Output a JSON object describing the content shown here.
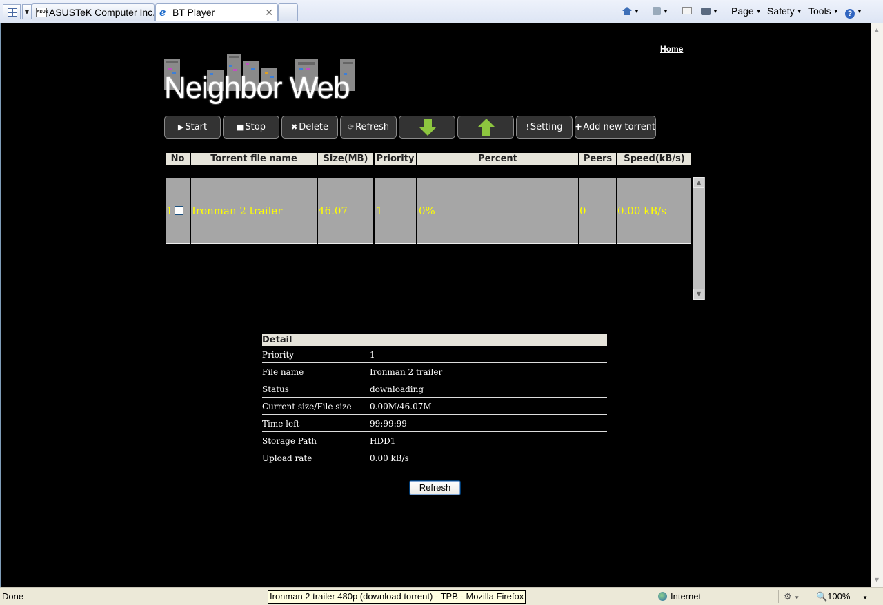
{
  "browser": {
    "tabs": [
      {
        "label": "ASUSTeK Computer Inc...",
        "icon": "asus-favicon-icon",
        "active": false
      },
      {
        "label": "BT Player",
        "icon": "ie-favicon-icon",
        "active": true,
        "close": "✕"
      }
    ],
    "command_bar": {
      "page": "Page",
      "safety": "Safety",
      "tools": "Tools",
      "help": "?"
    }
  },
  "header": {
    "home_link": "Home",
    "logo_text": "Neighbor Web"
  },
  "toolbar": {
    "start": "Start",
    "stop": "Stop",
    "delete": "Delete",
    "refresh": "Refresh",
    "setting": "Setting",
    "add_new": "Add new torrent",
    "download_icon": "arrow-down-icon",
    "upload_icon": "arrow-up-icon"
  },
  "table": {
    "columns": [
      "No",
      "Torrent file name",
      "Size(MB)",
      "Priority",
      "Percent",
      "Peers",
      "Speed(kB/s)"
    ],
    "rows": [
      {
        "no": "1",
        "name": "Ironman 2 trailer",
        "size": "46.07",
        "priority": "1",
        "percent": "0%",
        "peers": "0",
        "speed": "0.00 kB/s",
        "checked": false
      }
    ]
  },
  "detail": {
    "title": "Detail",
    "rows": [
      {
        "label": "Priority",
        "value": "1"
      },
      {
        "label": "File name",
        "value": "Ironman 2 trailer"
      },
      {
        "label": "Status",
        "value": "downloading"
      },
      {
        "label": "Current size/File size",
        "value": "0.00M/46.07M"
      },
      {
        "label": "Time left",
        "value": "99:99:99"
      },
      {
        "label": "Storage Path",
        "value": "HDD1"
      },
      {
        "label": "Upload rate",
        "value": "0.00 kB/s"
      }
    ],
    "refresh_button": "Refresh"
  },
  "statusbar": {
    "status": "Done",
    "tooltip": "Ironman 2 trailer 480p (download torrent) - TPB - Mozilla Firefox",
    "zone": "Internet",
    "zoom": "100%"
  },
  "colors": {
    "page_bg": "#000000",
    "row_text": "#ffff00",
    "row_bg": "#a6a6a6",
    "header_bg": "#e6e4da",
    "arrow_green": "#8dc63f"
  }
}
